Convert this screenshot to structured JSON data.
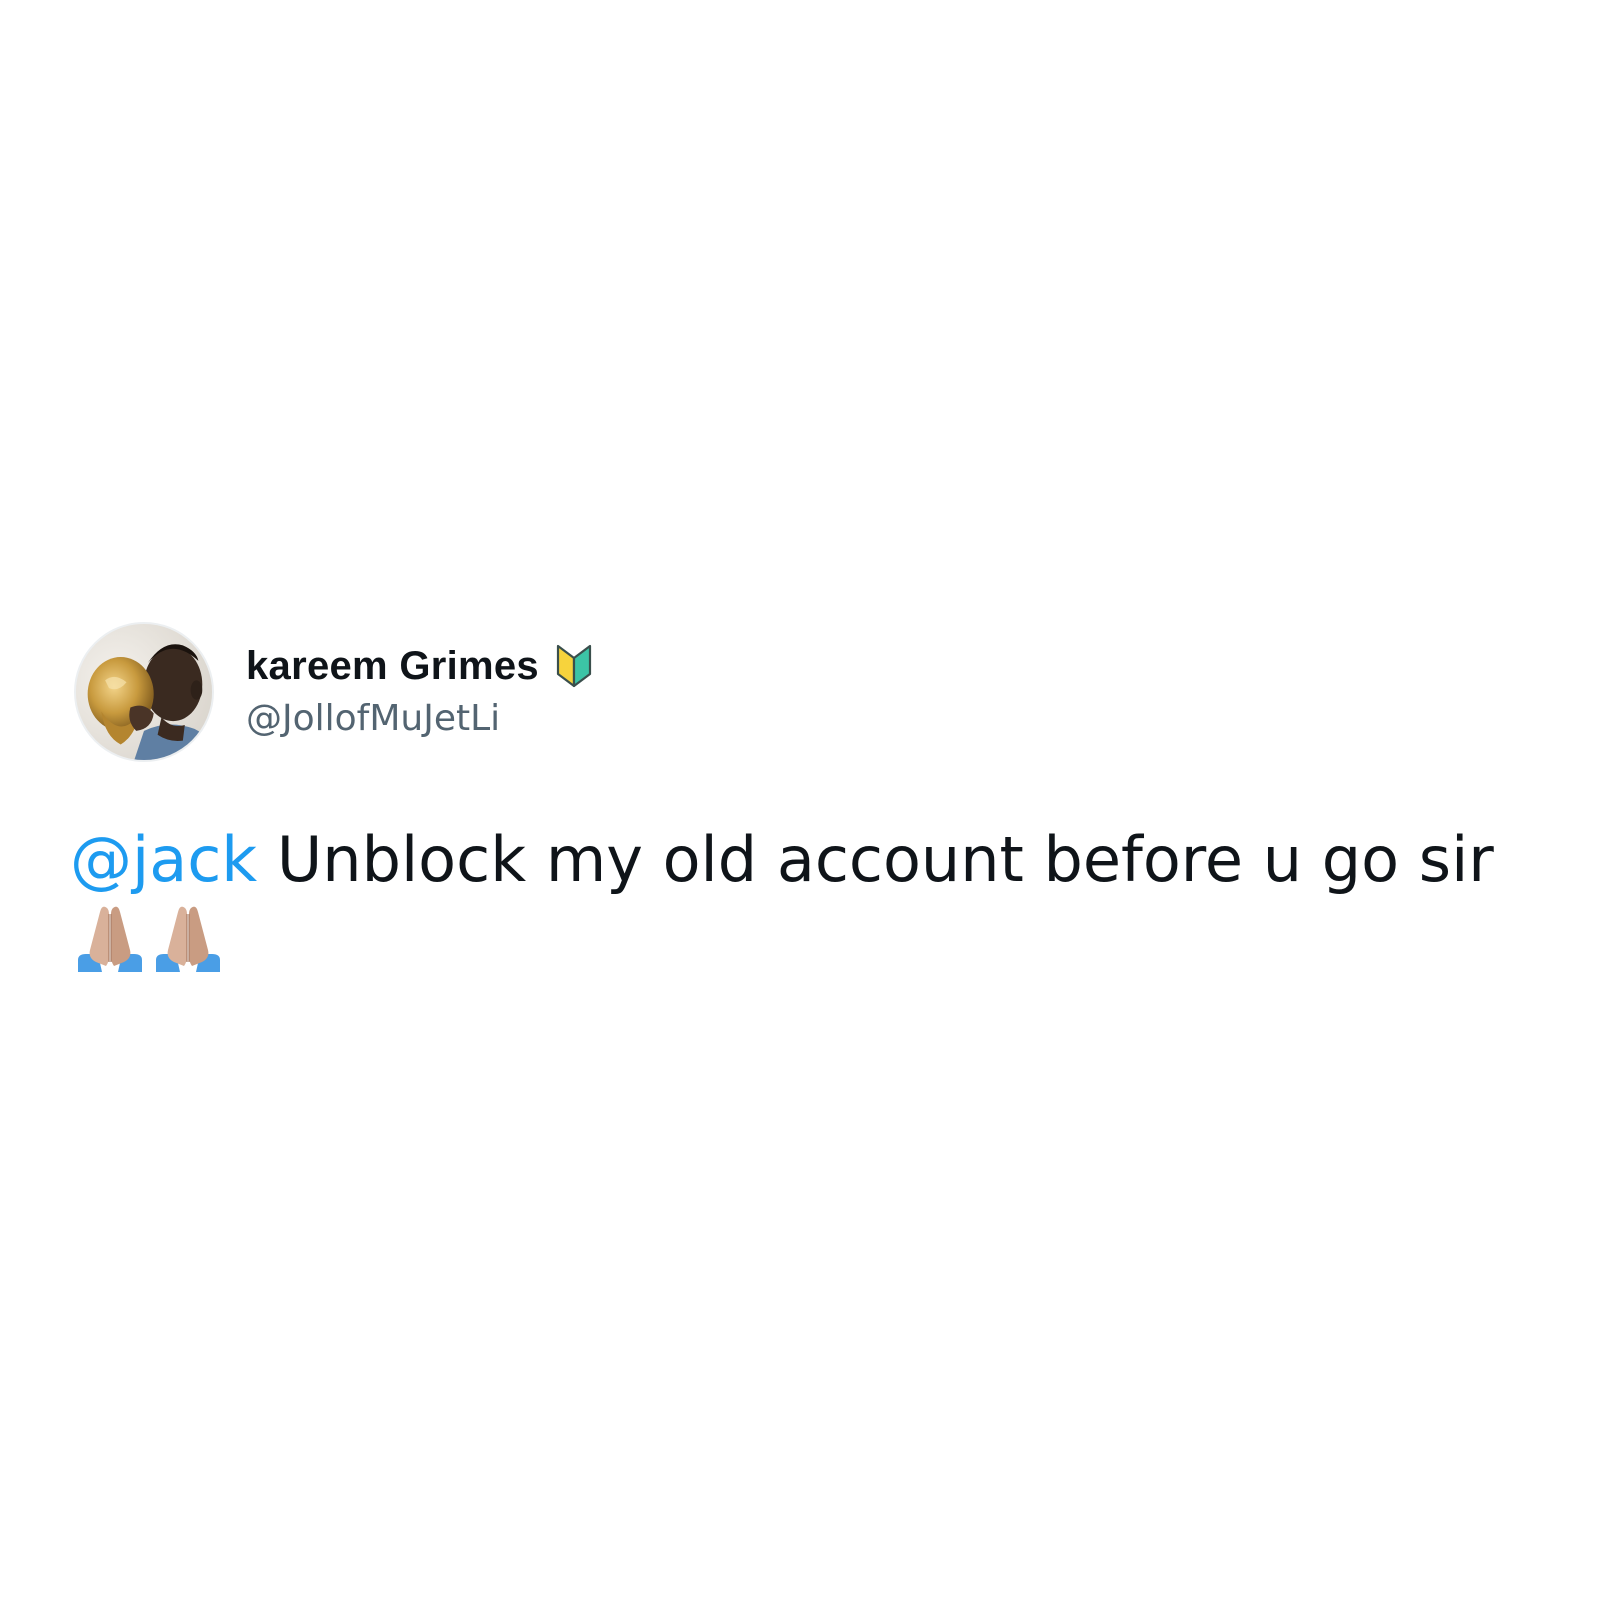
{
  "author": {
    "display_name": "kareem Grimes",
    "handle": "@JollofMuJetLi",
    "badge": "japanese-beginner-symbol-icon",
    "avatar": "profile-photo-avatar"
  },
  "tweet": {
    "mention": "@jack",
    "text": " Unblock my old account before u go sir",
    "emojis": [
      "folded-hands-icon",
      "folded-hands-icon"
    ]
  },
  "colors": {
    "mention_blue": "#1d9bf0",
    "text_primary": "#0f1419",
    "text_secondary": "#536471",
    "background": "#ffffff"
  }
}
